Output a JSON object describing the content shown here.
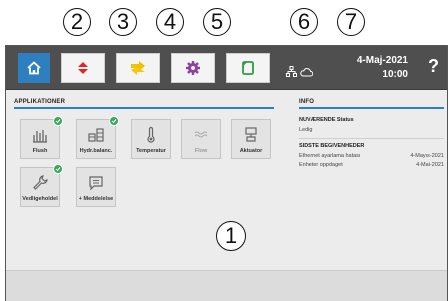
{
  "callouts": [
    "2",
    "3",
    "4",
    "5",
    "6",
    "7",
    "1"
  ],
  "topbar": {
    "home_icon": "home-icon",
    "tabs": [
      {
        "name": "tab-service",
        "icon": "red-arrows-icon",
        "color": "#e0242c"
      },
      {
        "name": "tab-status",
        "icon": "yellow-arrows-icon",
        "color": "#f2c200"
      },
      {
        "name": "tab-settings",
        "icon": "purple-gear-icon",
        "color": "#8e3fa0"
      },
      {
        "name": "tab-documents",
        "icon": "green-document-icon",
        "color": "#2f9a44"
      }
    ],
    "date": "4-Maj-2021",
    "time": "10:00",
    "help": "?"
  },
  "apps": {
    "title": "APPLIKATIONER",
    "tiles": [
      {
        "label": "Flush",
        "icon": "flush-icon",
        "checked": true,
        "disabled": false
      },
      {
        "label": "Hydr.balanc.",
        "icon": "hydraulic-balance-icon",
        "checked": true,
        "disabled": false
      },
      {
        "label": "Temperatur",
        "icon": "thermometer-icon",
        "checked": false,
        "disabled": false
      },
      {
        "label": "Flow",
        "icon": "flow-icon",
        "checked": false,
        "disabled": true
      },
      {
        "label": "Aktuator",
        "icon": "actuator-icon",
        "checked": false,
        "disabled": false
      },
      {
        "label": "Vedligeholdel",
        "icon": "wrench-icon",
        "checked": true,
        "disabled": false
      },
      {
        "label": "+ Meddelelse",
        "icon": "message-icon",
        "checked": false,
        "disabled": false
      }
    ]
  },
  "info": {
    "title": "INFO",
    "current_status_label": "NUVÆRENDE Status",
    "current_status_value": "Ledig",
    "events_label": "SIDSTE BEGIVENHEDER",
    "events": [
      {
        "text": "Ethernet ayarlama hatası",
        "date": "4-Mayıs-2021"
      },
      {
        "text": "Enheter oppdaget",
        "date": "4-Mai-2021"
      }
    ]
  },
  "colors": {
    "accent": "#2e7fc0",
    "check": "#3aa65a",
    "topbar": "#4f4f4f"
  }
}
